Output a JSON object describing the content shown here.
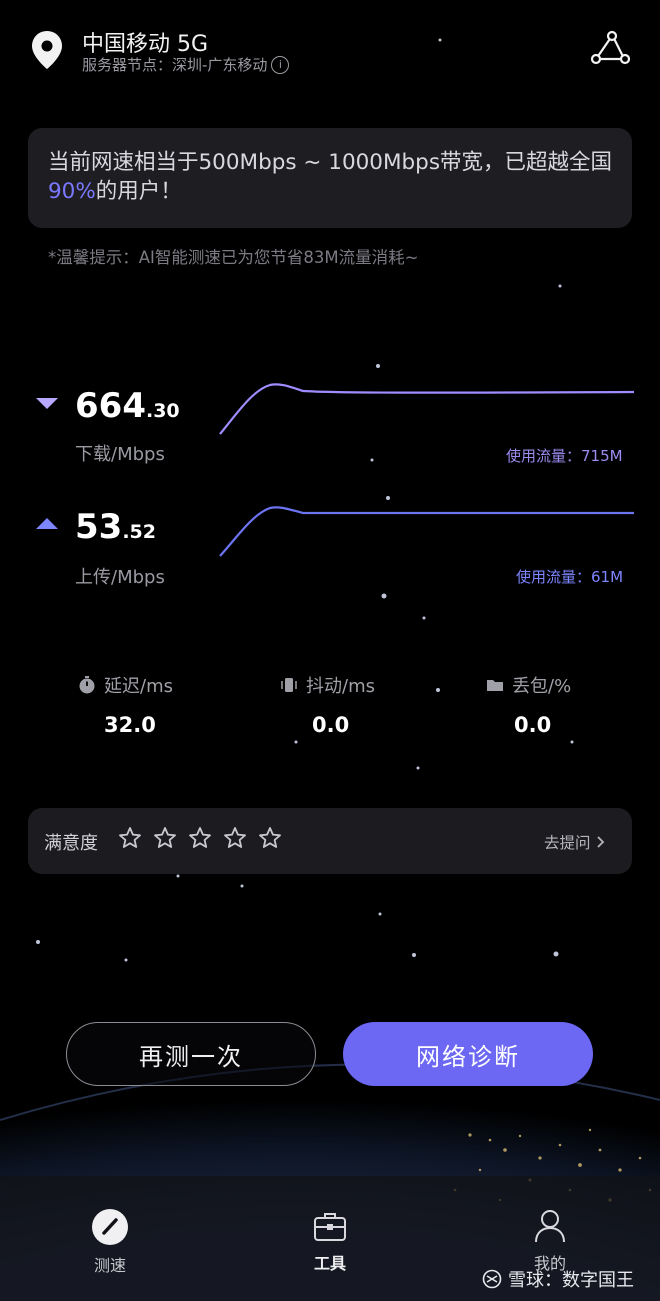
{
  "header": {
    "carrier": "中国移动 5G",
    "node_label": "服务器节点：深圳-广东移动",
    "info_icon": "info-icon",
    "share_icon": "share-icon",
    "location_icon": "location-pin-icon"
  },
  "summary": {
    "text_before": "当前网速相当于500Mbps ~ 1000Mbps带宽，已超越全国",
    "percent": "90%",
    "text_after": "的用户！"
  },
  "tip": "*温馨提示：AI智能测速已为您节省83M流量消耗~",
  "download": {
    "int": "664",
    "dec": ".30",
    "label": "下载/Mbps",
    "usage": "使用流量：715M"
  },
  "upload": {
    "int": "53",
    "dec": ".52",
    "label": "上传/Mbps",
    "usage": "使用流量：61M"
  },
  "stats": [
    {
      "label": "延迟/ms",
      "value": "32.0",
      "icon": "stopwatch-icon"
    },
    {
      "label": "抖动/ms",
      "value": "0.0",
      "icon": "vibration-icon"
    },
    {
      "label": "丢包/%",
      "value": "0.0",
      "icon": "folder-icon"
    }
  ],
  "satisfaction": {
    "label": "满意度",
    "rating": 0,
    "max": 5,
    "ask": "去提问"
  },
  "buttons": {
    "again": "再测一次",
    "diagnose": "网络诊断"
  },
  "nav": [
    {
      "label": "测速",
      "icon": "speedometer-icon"
    },
    {
      "label": "工具",
      "icon": "toolbox-icon"
    },
    {
      "label": "我的",
      "icon": "user-icon"
    }
  ],
  "watermark": "雪球：数字国王",
  "colors": {
    "accent": "#6c68f4",
    "percent": "#7a78ff",
    "download": "#b9a8ff",
    "upload": "#7d86ff"
  }
}
